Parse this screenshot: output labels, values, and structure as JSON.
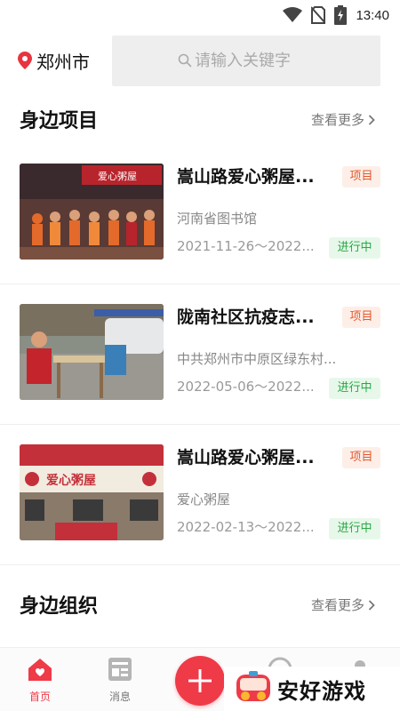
{
  "status_bar": {
    "time": "13:40"
  },
  "header": {
    "city": "郑州市",
    "search_placeholder": "请输入关键字"
  },
  "nearby_projects": {
    "title": "身边项目",
    "more": "查看更多",
    "items": [
      {
        "title": "嵩山路爱心粥屋...",
        "tag": "项目",
        "org": "河南省图书馆",
        "date": "2021-11-26～2022...",
        "status": "进行中",
        "photo_sign": "爱心粥屋"
      },
      {
        "title": "陇南社区抗疫志...",
        "tag": "项目",
        "org": "中共郑州市中原区绿东村...",
        "date": "2022-05-06～2022...",
        "status": "进行中"
      },
      {
        "title": "嵩山路爱心粥屋...",
        "tag": "项目",
        "org": "爱心粥屋",
        "date": "2022-02-13～2022...",
        "status": "进行中",
        "photo_sign": "爱心粥屋"
      }
    ]
  },
  "nearby_orgs": {
    "title": "身边组织",
    "more": "查看更多"
  },
  "bottom_nav": {
    "home": "首页",
    "messages": "消息"
  },
  "watermark": {
    "text": "安好游戏"
  },
  "colors": {
    "accent": "#ef3a48",
    "tag_text": "#e2592e",
    "status_text": "#27a844"
  }
}
